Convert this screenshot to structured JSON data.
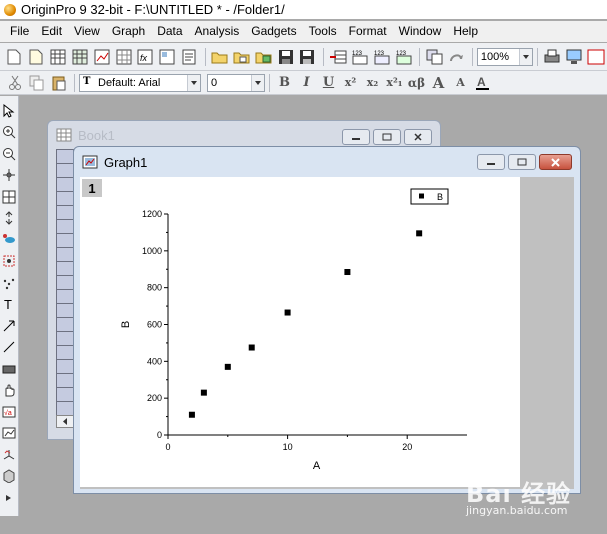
{
  "window": {
    "title": "OriginPro 9 32-bit - F:\\UNTITLED * - /Folder1/"
  },
  "menu": [
    "File",
    "Edit",
    "View",
    "Graph",
    "Data",
    "Analysis",
    "Gadgets",
    "Tools",
    "Format",
    "Window",
    "Help"
  ],
  "toolbar": {
    "zoom_value": "100%",
    "font_value": "Default: Arial",
    "font_size_value": "0",
    "bold_label": "B",
    "italic_label": "I",
    "underline_label": "U",
    "superscript_label": "x²",
    "subscript_label": "x₂",
    "supsub_label": "x²₁",
    "greek_label": "αβ",
    "increase_font_label": "A",
    "decrease_font_label": "A"
  },
  "book1": {
    "title": "Book1"
  },
  "graph1": {
    "title": "Graph1",
    "layer_label": "1"
  },
  "colors": {
    "accent": "#000000",
    "page": "#ffffff",
    "workspace": "#a9a9a9",
    "close_button": "#c7523e"
  },
  "chart_data": {
    "type": "scatter",
    "xlabel": "A",
    "ylabel": "B",
    "xlim": [
      0,
      25
    ],
    "ylim": [
      0,
      1200
    ],
    "xticks": [
      "0",
      "10",
      "20"
    ],
    "yticks": [
      "0",
      "200",
      "400",
      "600",
      "800",
      "1000",
      "1200"
    ],
    "legend": {
      "placement": "top-right",
      "entries": [
        "B"
      ]
    },
    "grid": false,
    "series": [
      {
        "name": "B",
        "marker": "square",
        "color": "#000000",
        "x": [
          2,
          3,
          5,
          7,
          10,
          15,
          21
        ],
        "y": [
          110,
          230,
          370,
          475,
          665,
          885,
          1095
        ]
      }
    ]
  },
  "watermark": {
    "brand": "Bai 经验",
    "url": "jingyan.baidu.com"
  }
}
